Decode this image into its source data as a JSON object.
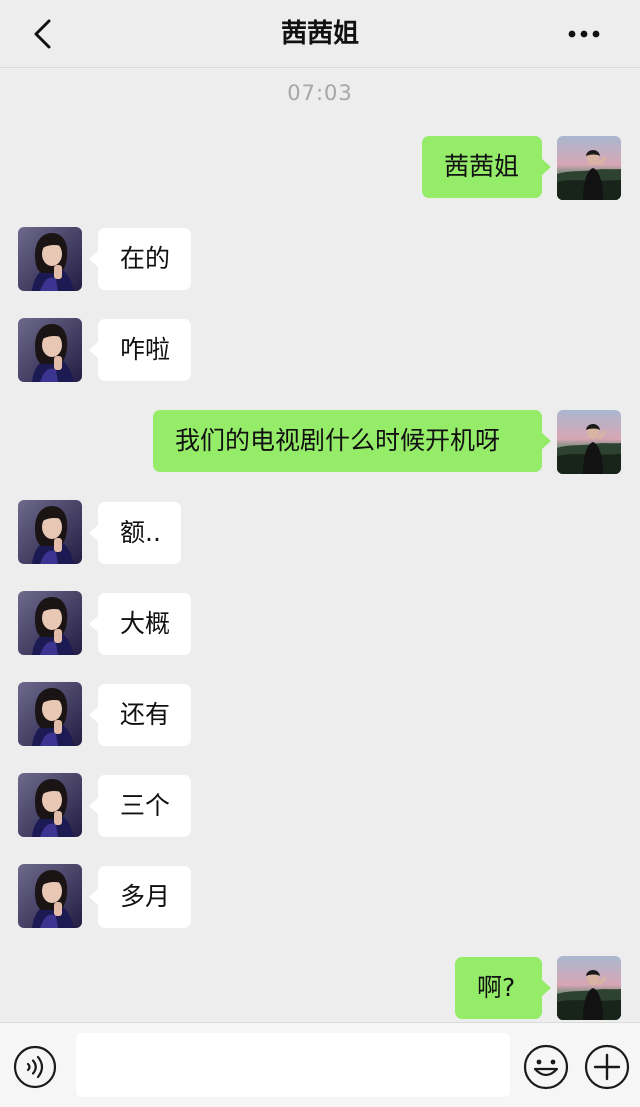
{
  "header": {
    "title": "茜茜姐",
    "back_icon": "chevron-left-icon",
    "more_icon": "more-dots-icon"
  },
  "chat": {
    "timestamp": "07:03",
    "messages": [
      {
        "side": "right",
        "text": "茜茜姐"
      },
      {
        "side": "left",
        "text": "在的"
      },
      {
        "side": "left",
        "text": "咋啦"
      },
      {
        "side": "right",
        "text": "我们的电视剧什么时候开机呀"
      },
      {
        "side": "left",
        "text": "额.."
      },
      {
        "side": "left",
        "text": "大概"
      },
      {
        "side": "left",
        "text": "还有"
      },
      {
        "side": "left",
        "text": "三个"
      },
      {
        "side": "left",
        "text": "多月"
      },
      {
        "side": "right",
        "text": "啊?"
      }
    ]
  },
  "input_bar": {
    "voice_icon": "voice-icon",
    "message_value": "",
    "emoji_icon": "emoji-icon",
    "plus_icon": "plus-icon"
  },
  "colors": {
    "background": "#ededed",
    "bubble_self": "#95ec69",
    "bubble_other": "#ffffff",
    "timestamp": "#a6a6a6"
  }
}
